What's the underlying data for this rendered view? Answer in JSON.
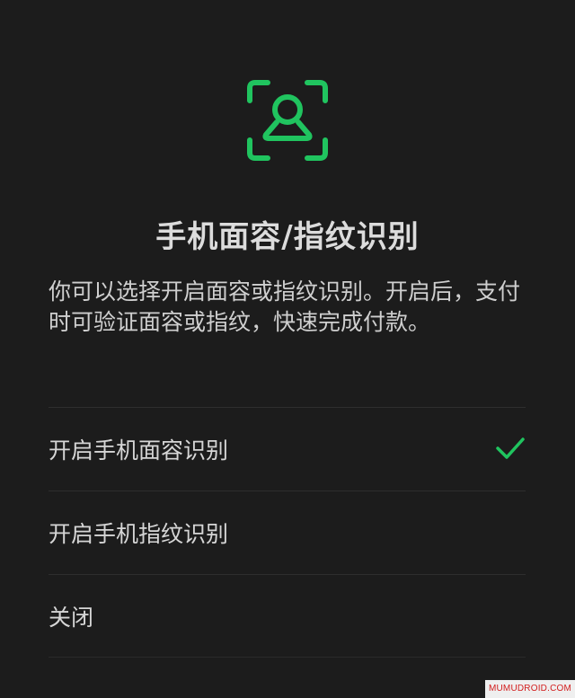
{
  "header": {
    "icon": "face-recognition-icon",
    "title": "手机面容/指纹识别",
    "description": "你可以选择开启面容或指纹识别。开启后，支付时可验证面容或指纹，快速完成付款。"
  },
  "options": [
    {
      "label": "开启手机面容识别",
      "selected": true
    },
    {
      "label": "开启手机指纹识别",
      "selected": false
    },
    {
      "label": "关闭",
      "selected": false
    }
  ],
  "watermark": "MUMUDROID.COM",
  "colors": {
    "background": "#1c1c1c",
    "accent": "#20c45f",
    "text": "#d8d8d8"
  }
}
